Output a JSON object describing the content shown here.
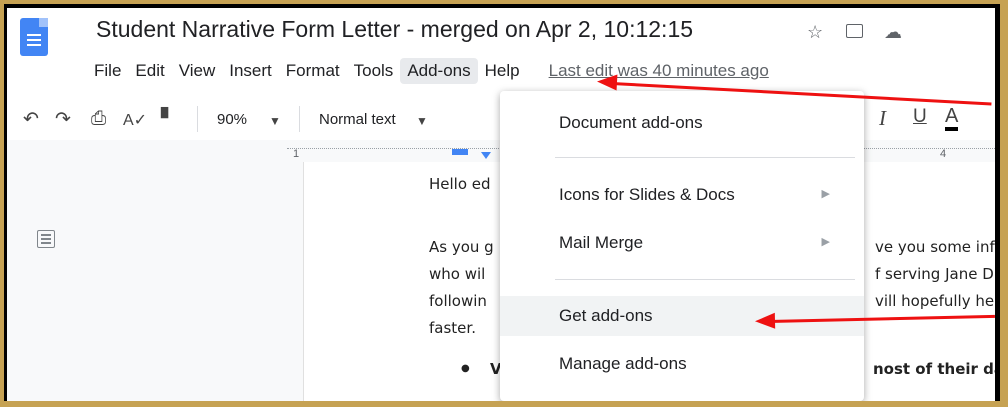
{
  "window": {
    "doc_title": "Student Narrative Form Letter - merged on Apr 2, 10:12:15",
    "icons": [
      "star-icon",
      "move-to-folder-icon",
      "cloud-status-icon"
    ]
  },
  "menubar": {
    "items": [
      "File",
      "Edit",
      "View",
      "Insert",
      "Format",
      "Tools",
      "Add-ons",
      "Help"
    ],
    "last_edit": "Last edit was 40 minutes ago"
  },
  "toolbar": {
    "zoom": "90%",
    "style": "Normal text",
    "italic": "I",
    "underline": "U",
    "text_color": "A"
  },
  "ruler": {
    "mark1": "1",
    "mark4": "4"
  },
  "addons_menu": {
    "items": [
      {
        "label": "Document add-ons",
        "submenu": false
      },
      {
        "label": "Icons for Slides & Docs",
        "submenu": true
      },
      {
        "label": "Mail Merge",
        "submenu": true
      },
      {
        "label": "Get add-ons",
        "submenu": false
      },
      {
        "label": "Manage add-ons",
        "submenu": false
      }
    ]
  },
  "document": {
    "greeting": "Hello ed",
    "left_lines": [
      "As you g",
      "who wil",
      "followin",
      "faster."
    ],
    "right_lines": [
      "ve you some inf",
      "f serving Jane D",
      "vill hopefully he"
    ],
    "bullet_text": "V",
    "bold_right": "nost of their da"
  },
  "colors": {
    "annotation": "#ee1111",
    "frame": "#c6a253",
    "docs_blue": "#4285f4"
  }
}
